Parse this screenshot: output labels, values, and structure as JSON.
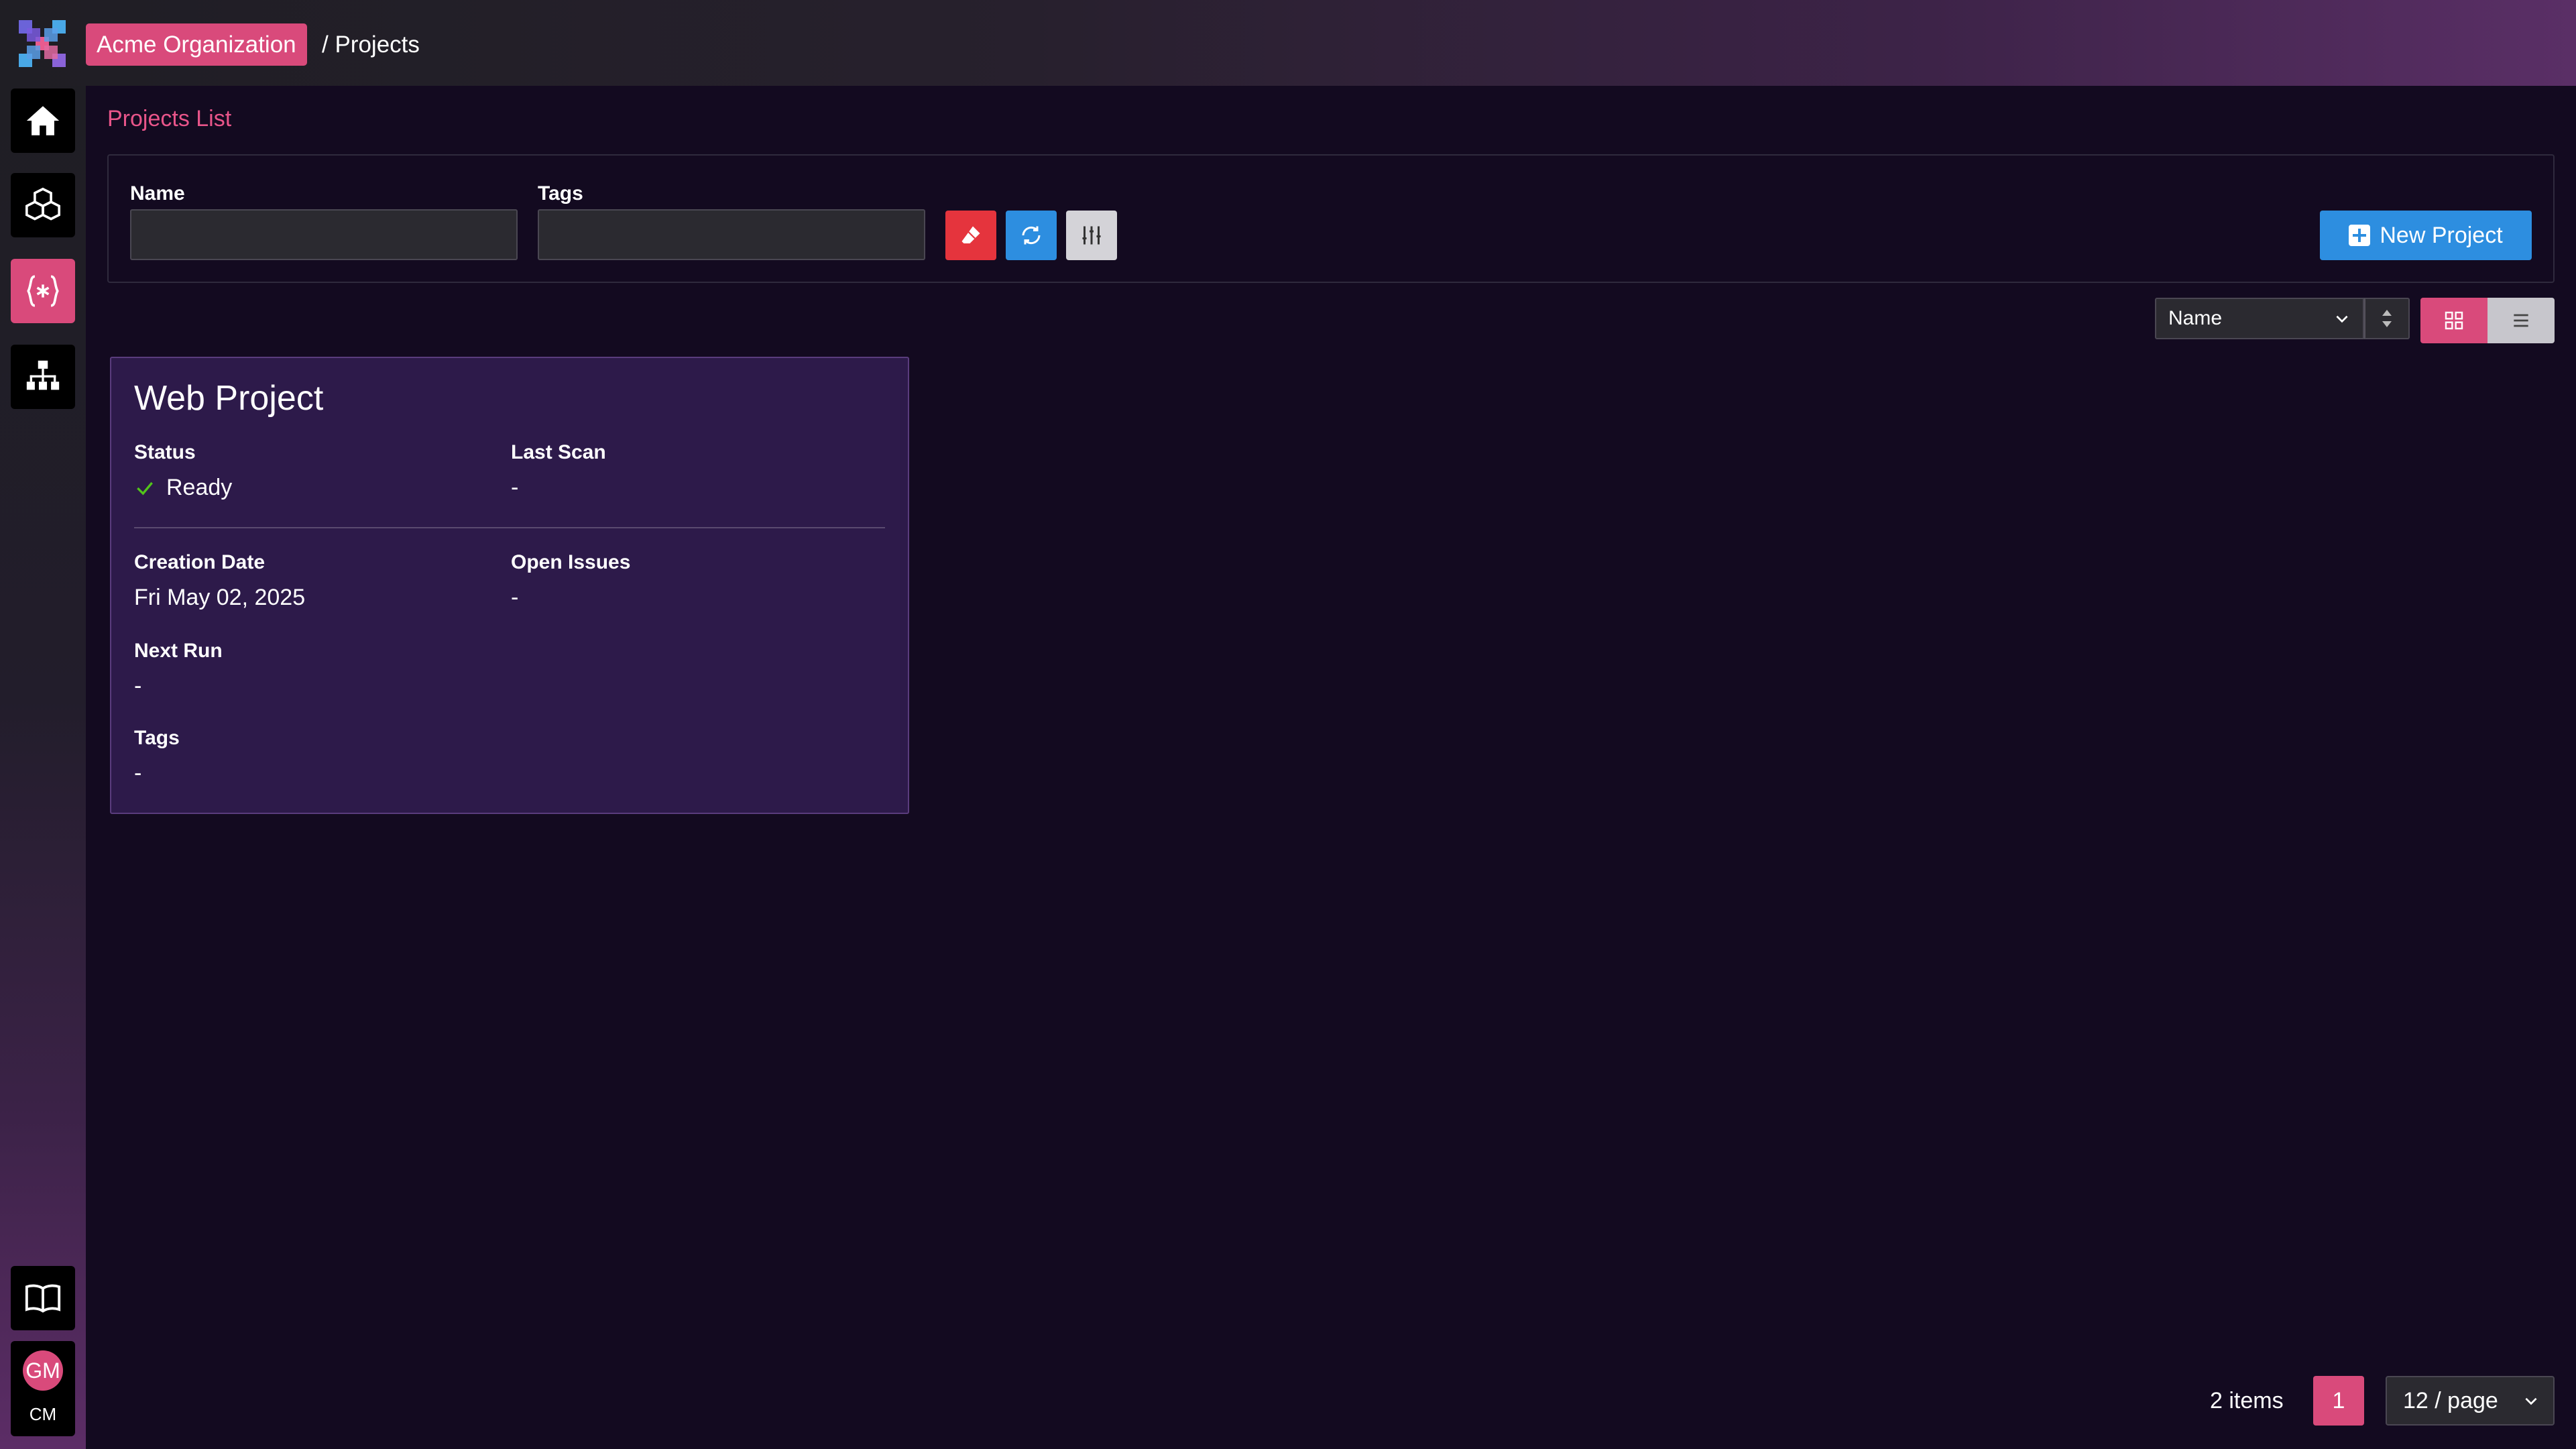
{
  "header": {
    "org_name": "Acme Organization",
    "breadcrumb": "/ Projects",
    "logo_icon": "app-logo-icon"
  },
  "sidebar": {
    "items": [
      {
        "name": "home",
        "icon": "home-icon",
        "active": false
      },
      {
        "name": "assets",
        "icon": "cubes-icon",
        "active": false
      },
      {
        "name": "projects",
        "icon": "braces-asterisk-icon",
        "active": true
      },
      {
        "name": "sitemap",
        "icon": "sitemap-icon",
        "active": false
      }
    ],
    "docs_icon": "book-icon",
    "user": {
      "avatar_initials": "GM",
      "org_initials": "CM"
    }
  },
  "main": {
    "title": "Projects List",
    "filters": {
      "name_label": "Name",
      "name_value": "",
      "tags_label": "Tags",
      "tags_value": ""
    },
    "new_project_label": "New Project",
    "sort": {
      "selected": "Name"
    },
    "view_mode": "grid"
  },
  "projects": [
    {
      "title": "Web Project",
      "status_label": "Status",
      "status_value": "Ready",
      "last_scan_label": "Last Scan",
      "last_scan_value": "-",
      "creation_date_label": "Creation Date",
      "creation_date_value": "Fri May 02, 2025",
      "open_issues_label": "Open Issues",
      "open_issues_value": "-",
      "next_run_label": "Next Run",
      "next_run_value": "-",
      "tags_label": "Tags",
      "tags_value": "-"
    }
  ],
  "pagination": {
    "items_text": "2 items",
    "current_page": "1",
    "page_size": "12 / page"
  },
  "colors": {
    "accent": "#d94a7b",
    "primary_blue": "#2d8ee0",
    "danger_red": "#e5343d",
    "background": "#130a20",
    "card": "#2d1a4a",
    "success": "#52c41a"
  }
}
